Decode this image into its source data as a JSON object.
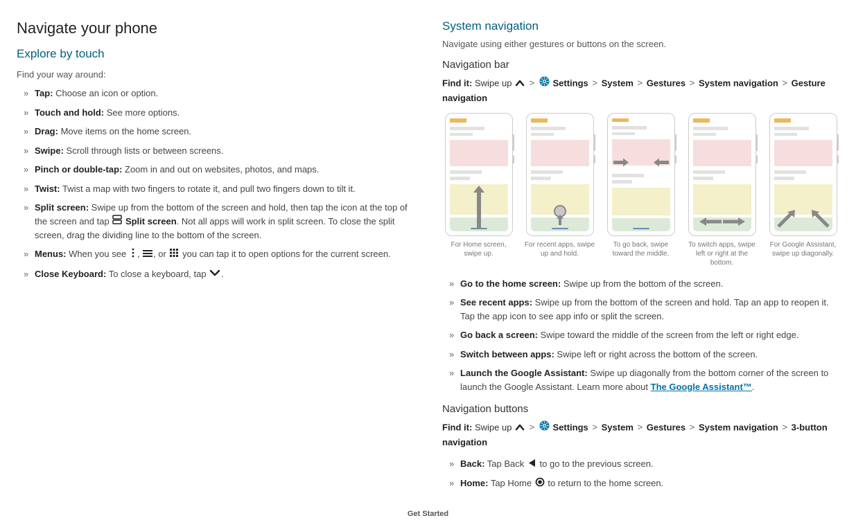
{
  "left": {
    "title": "Navigate your phone",
    "section": "Explore by touch",
    "intro": "Find your way around:",
    "items": [
      {
        "label": "Tap:",
        "text": " Choose an icon or option."
      },
      {
        "label": "Touch and hold:",
        "text": " See more options."
      },
      {
        "label": "Drag:",
        "text": " Move items on the home screen."
      },
      {
        "label": "Swipe:",
        "text": " Scroll through lists or between screens."
      },
      {
        "label": "Pinch or double-tap:",
        "text": " Zoom in and out on websites, photos, and maps."
      },
      {
        "label": "Twist:",
        "text": " Twist a map with two fingers to rotate it, and pull two fingers down to tilt it."
      },
      {
        "label": "Split screen:",
        "pre": " Swipe up from the bottom of the screen and hold, then tap the icon at the top of the screen and tap ",
        "mid": "Split screen",
        "post": ". Not all apps will work in split screen. To close the split screen, drag the dividing line to the bottom of the screen."
      },
      {
        "label": "Menus:",
        "pre": " When you see ",
        "post": " you can tap it to open options for the current screen."
      },
      {
        "label": "Close Keyboard:",
        "pre": " To close a keyboard, tap "
      }
    ]
  },
  "right": {
    "title": "System navigation",
    "intro": "Navigate using either gestures or buttons on the screen.",
    "navbar": {
      "heading": "Navigation bar",
      "findit_label": "Find it:",
      "swipeup": " Swipe up ",
      "path": [
        "Settings",
        "System",
        "Gestures",
        "System navigation",
        "Gesture navigation"
      ],
      "phones": [
        "For Home screen, swipe up.",
        "For recent apps, swipe up and hold.",
        "To go back, swipe toward the middle.",
        "To switch apps, swipe left or right at the bottom.",
        "For Google Assistant, swipe up diagonally."
      ],
      "items": [
        {
          "label": "Go to the home screen:",
          "text": " Swipe up from the bottom of the screen."
        },
        {
          "label": "See recent apps:",
          "text": " Swipe up from the bottom of the screen and hold. Tap an app to reopen it. Tap the app icon to see app info or split the screen."
        },
        {
          "label": "Go back a screen:",
          "text": " Swipe toward the middle of the screen from the left or right edge."
        },
        {
          "label": "Switch between apps:",
          "text": " Swipe left or right across the bottom of the screen."
        },
        {
          "label": "Launch the Google Assistant:",
          "pre": " Swipe up diagonally from the bottom corner of the screen to launch the Google Assistant. Learn more about ",
          "link": "The Google Assistant™",
          "post": "."
        }
      ]
    },
    "navbuttons": {
      "heading": "Navigation buttons",
      "findit_label": "Find it:",
      "swipeup": " Swipe up ",
      "path": [
        "Settings",
        "System",
        "Gestures",
        "System navigation",
        "3-button navigation"
      ],
      "items": [
        {
          "label": "Back:",
          "pre": " Tap Back ",
          "post": " to go to the previous screen."
        },
        {
          "label": "Home:",
          "pre": " Tap Home ",
          "post": " to return to the home screen."
        }
      ]
    }
  },
  "footer": "Get Started"
}
